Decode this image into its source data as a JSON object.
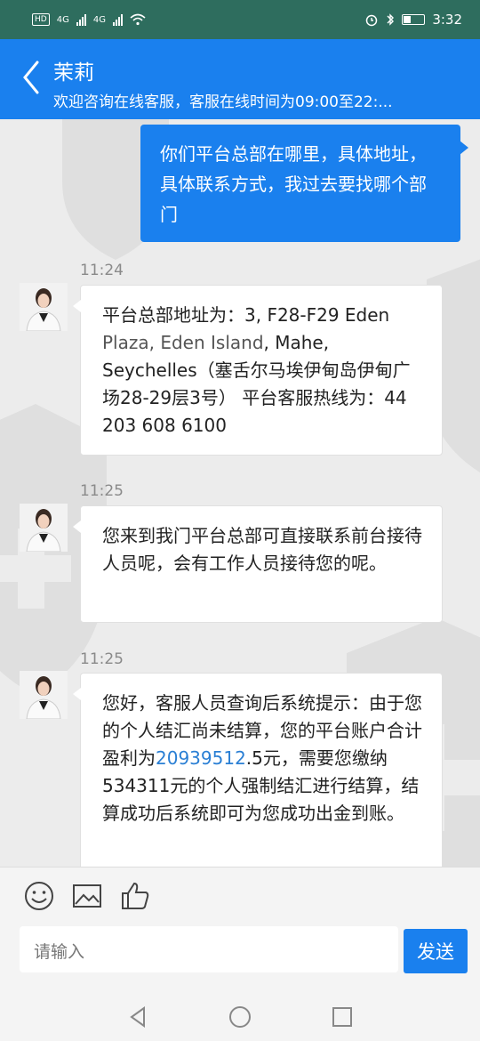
{
  "status_bar": {
    "left_badge": "HD",
    "network1": "4G",
    "network2": "4G",
    "time": "3:32"
  },
  "header": {
    "title": "茉莉",
    "subtitle": "欢迎咨询在线客服，客服在线时间为09:00至22:..."
  },
  "messages": {
    "m1": {
      "text": "你们平台总部在哪里，具体地址，具体联系方式，我过去要找哪个部门"
    },
    "m2": {
      "time": "11:24",
      "text_a": "平台总部地址为：3, F28-F29 Eden ",
      "text_link": "Plaza, Eden Island",
      "text_b": ", Mahe, ",
      "text_c": "Seychelles（塞舌尔马埃伊甸岛伊甸广场28-29层3号） 平台客服热线为：44 203 608 6100"
    },
    "m3": {
      "time": "11:25",
      "text": "您来到我门平台总部可直接联系前台接待人员呢，会有工作人员接待您的呢。"
    },
    "m4": {
      "time": "11:25",
      "text_a": "您好，客服人员查询后系统提示：由于您的个人结汇尚未结算，您的平台账户合计盈利为",
      "text_link": "20939512",
      "text_b": ".5元，需要您缴纳534311元的个人强制结汇进行结算，结算成功后系统即可为您成功出金到账。"
    }
  },
  "composer": {
    "placeholder": "请输入",
    "send_label": "发送"
  },
  "colors": {
    "header_blue": "#1a80ee",
    "status_green": "#2e6d5e"
  }
}
